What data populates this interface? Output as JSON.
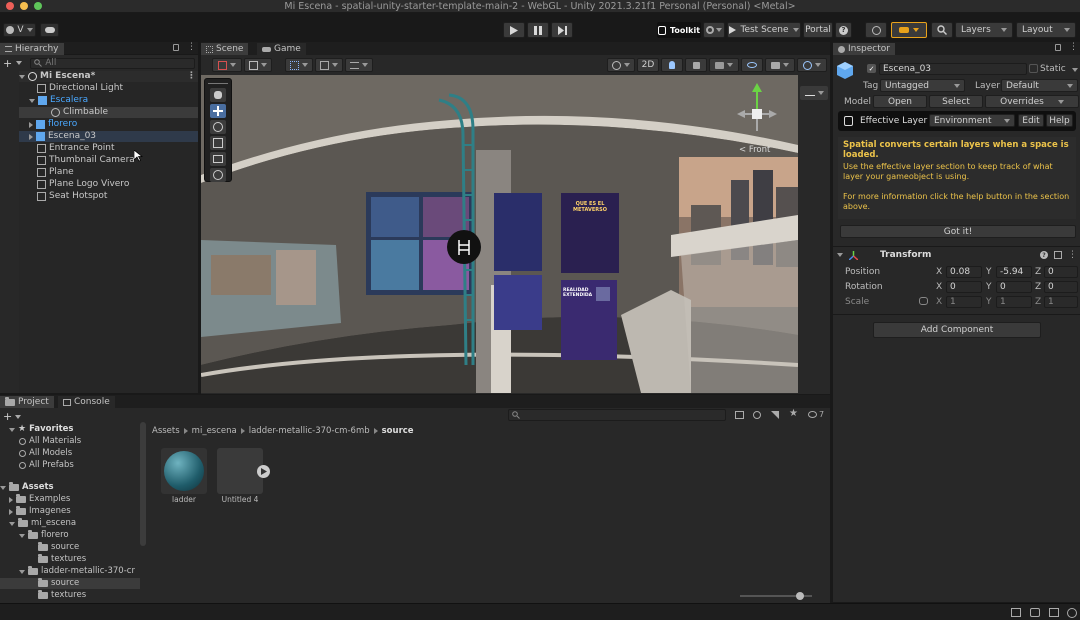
{
  "window": {
    "title": "Mi Escena - spatial-unity-starter-template-main-2 - WebGL - Unity 2021.3.21f1 Personal (Personal) <Metal>"
  },
  "toolbar": {
    "account_label": "V",
    "toolkit_label": "Toolkit",
    "test_scene_label": "Test Scene",
    "portal_label": "Portal",
    "layers_label": "Layers",
    "layout_label": "Layout"
  },
  "hierarchy": {
    "tab_label": "Hierarchy",
    "search_placeholder": "All",
    "scene_name": "Mi Escena*",
    "items": [
      {
        "label": "Directional Light"
      },
      {
        "label": "Escalera"
      },
      {
        "label": "Climbable"
      },
      {
        "label": "florero"
      },
      {
        "label": "Escena_03"
      },
      {
        "label": "Entrance Point"
      },
      {
        "label": "Thumbnail Camera"
      },
      {
        "label": "Plane"
      },
      {
        "label": "Plane Logo Vivero"
      },
      {
        "label": "Seat Hotspot"
      }
    ]
  },
  "scene": {
    "tabs": [
      {
        "label": "Scene"
      },
      {
        "label": "Game"
      }
    ],
    "mode_2d_label": "2D",
    "gizmo_label": "< Front",
    "posters": [
      {
        "title": "QUE ES EL METAVERSO"
      },
      {
        "title": "REALIDAD EXTENDIDA"
      }
    ]
  },
  "project": {
    "tabs": [
      {
        "label": "Project"
      },
      {
        "label": "Console"
      }
    ],
    "breadcrumb": [
      "Assets",
      "mi_escena",
      "ladder-metallic-370-cm-6mb",
      "source"
    ],
    "hidden_count": "7",
    "favorites": {
      "label": "Favorites",
      "items": [
        {
          "label": "All Materials"
        },
        {
          "label": "All Models"
        },
        {
          "label": "All Prefabs"
        }
      ]
    },
    "tree": [
      {
        "label": "Assets"
      },
      {
        "label": "Examples"
      },
      {
        "label": "Imagenes"
      },
      {
        "label": "mi_escena"
      },
      {
        "label": "florero"
      },
      {
        "label": "source"
      },
      {
        "label": "textures"
      },
      {
        "label": "ladder-metallic-370-cr"
      },
      {
        "label": "source"
      },
      {
        "label": "textures"
      }
    ],
    "assets": [
      {
        "label": "ladder"
      },
      {
        "label": "Untitled 4"
      }
    ]
  },
  "inspector": {
    "tab_label": "Inspector",
    "object_name": "Escena_03",
    "static_label": "Static",
    "tag_label": "Tag",
    "tag_value": "Untagged",
    "layer_label": "Layer",
    "layer_value": "Default",
    "model_label": "Model",
    "open_label": "Open",
    "select_label": "Select",
    "overrides_label": "Overrides",
    "effective_layer_label": "Effective Layer",
    "effective_layer_value": "Environment",
    "edit_label": "Edit",
    "help_label": "Help",
    "info_title": "Spatial converts certain layers when a space is loaded.",
    "info_body": "Use the effective layer section to keep track of what layer your gameobject is using.",
    "info_more": "For more information click the help button in the section above.",
    "got_it_label": "Got it!",
    "transform_label": "Transform",
    "position_label": "Position",
    "rotation_label": "Rotation",
    "scale_label": "Scale",
    "axis_x": "X",
    "axis_y": "Y",
    "axis_z": "Z",
    "position": {
      "x": "0.08",
      "y": "-5.94",
      "z": "0"
    },
    "rotation": {
      "x": "0",
      "y": "0",
      "z": "0"
    },
    "scale": {
      "x": "1",
      "y": "1",
      "z": "1"
    },
    "add_component_label": "Add Component"
  }
}
